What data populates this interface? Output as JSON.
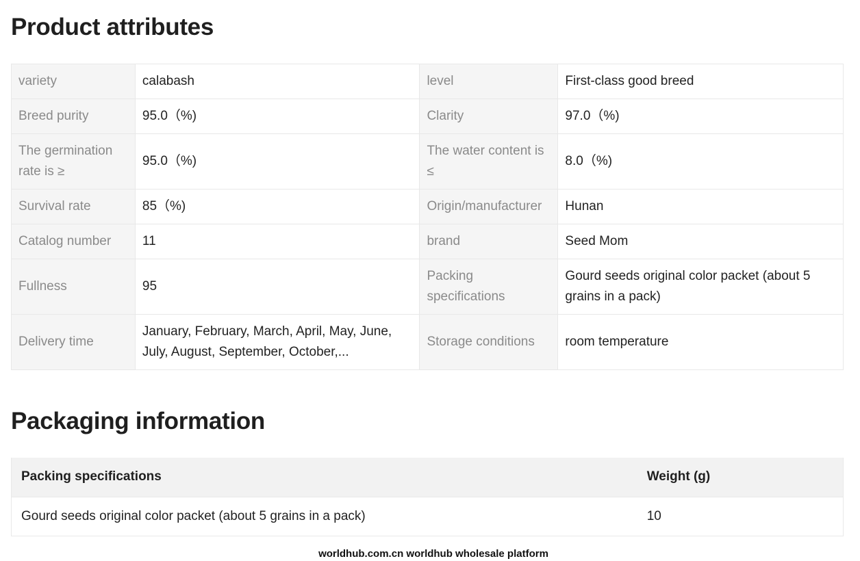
{
  "attributes": {
    "title": "Product attributes",
    "rows": [
      [
        "variety",
        "calabash",
        "level",
        "First-class good breed"
      ],
      [
        "Breed purity",
        "95.0（%)",
        "Clarity",
        "97.0（%)"
      ],
      [
        "The germination rate is ≥",
        "95.0（%)",
        "The water content is ≤",
        "8.0（%)"
      ],
      [
        "Survival rate",
        "85（%)",
        "Origin/manufacturer",
        "Hunan"
      ],
      [
        "Catalog number",
        "11",
        "brand",
        "Seed Mom"
      ],
      [
        "Fullness",
        "95",
        "Packing specifications",
        "Gourd seeds original color packet (about 5 grains in a pack)"
      ],
      [
        "Delivery time",
        "January, February, March, April, May, June, July, August, September, October,...",
        "Storage conditions",
        "room temperature"
      ]
    ]
  },
  "packaging": {
    "title": "Packaging information",
    "headers": [
      "Packing specifications",
      "Weight (g)"
    ],
    "rows": [
      [
        "Gourd seeds original color packet (about 5 grains in a pack)",
        "10"
      ]
    ]
  },
  "footer": {
    "text": "worldhub.com.cn worldhub wholesale platform"
  }
}
